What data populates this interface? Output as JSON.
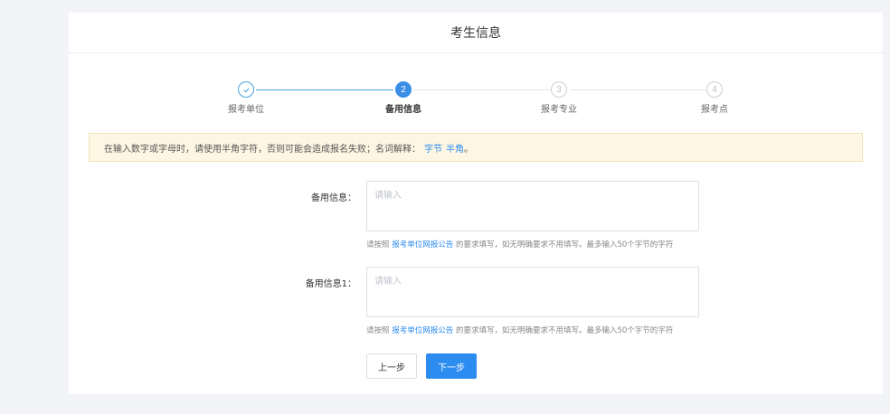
{
  "header": {
    "title": "考生信息"
  },
  "steps": [
    {
      "number": "1",
      "label": "报考单位",
      "state": "done"
    },
    {
      "number": "2",
      "label": "备用信息",
      "state": "active"
    },
    {
      "number": "3",
      "label": "报考专业",
      "state": "todo"
    },
    {
      "number": "4",
      "label": "报考点",
      "state": "todo"
    }
  ],
  "notice": {
    "text": "在输入数字或字母时，请使用半角字符，否则可能会造成报名失败；名词解释：",
    "link_bytes": "字节",
    "link_halfwidth": "半角",
    "end": "。"
  },
  "fields": [
    {
      "label": "备用信息：",
      "placeholder": "请输入",
      "value": "",
      "hint_prefix": "请按照",
      "hint_link": "报考单位网报公告",
      "hint_suffix": "的要求填写，如无明确要求不用填写。最多输入50个字节的字符"
    },
    {
      "label": "备用信息1：",
      "placeholder": "请输入",
      "value": "",
      "hint_prefix": "请按照",
      "hint_link": "报考单位网报公告",
      "hint_suffix": "的要求填写，如无明确要求不用填写。最多输入50个字节的字符"
    }
  ],
  "buttons": {
    "prev_label": "上一步",
    "next_label": "下一步"
  },
  "colors": {
    "primary": "#2d8cf0",
    "notice_bg": "#fdf6e3"
  },
  "icons": {
    "step_done": "check-icon"
  }
}
